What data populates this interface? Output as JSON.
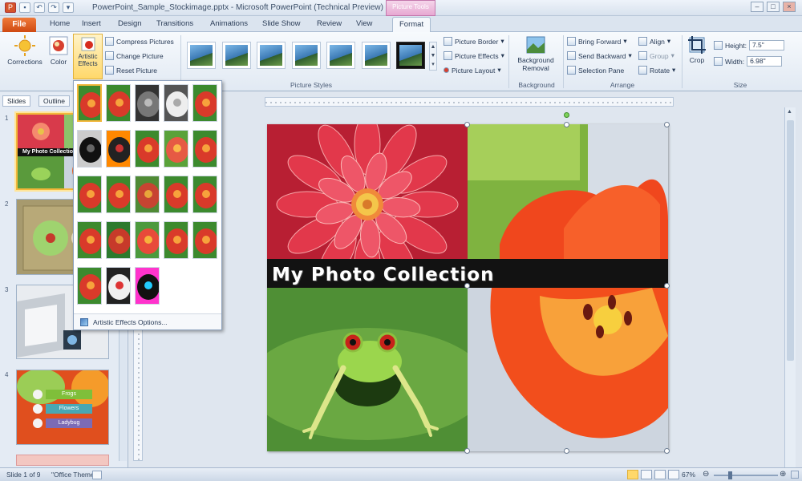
{
  "title_bar": {
    "title": "PowerPoint_Sample_Stockimage.pptx - Microsoft PowerPoint (Technical Preview)",
    "context_tab": "Picture Tools",
    "qat": [
      "save-icon",
      "undo-icon",
      "redo-icon",
      "customize-icon"
    ],
    "window_buttons": [
      "–",
      "□",
      "×"
    ]
  },
  "tabs": {
    "file": "File",
    "items": [
      "Home",
      "Insert",
      "Design",
      "Transitions",
      "Animations",
      "Slide Show",
      "Review",
      "View",
      "Format"
    ],
    "active": "Format"
  },
  "ribbon": {
    "corrections": "Corrections",
    "color": "Color",
    "artistic_effects": "Artistic Effects",
    "compress": "Compress Pictures",
    "change": "Change Picture",
    "reset": "Reset Picture",
    "picture_styles_label": "Picture Styles",
    "picture_border": "Picture Border",
    "picture_effects": "Picture Effects",
    "picture_layout": "Picture Layout",
    "background_removal": "Background Removal",
    "background_label": "Background",
    "bring_forward": "Bring Forward",
    "send_backward": "Send Backward",
    "selection_pane": "Selection Pane",
    "align": "Align",
    "group": "Group",
    "rotate": "Rotate",
    "arrange_label": "Arrange",
    "crop": "Crop",
    "height_label": "Height:",
    "height_value": "7.5\"",
    "width_label": "Width:",
    "width_value": "6.98\"",
    "size_label": "Size"
  },
  "left_panel": {
    "tabs": [
      "Slides",
      "Outline"
    ],
    "slide_numbers": [
      "1",
      "2",
      "3",
      "4"
    ],
    "thumb1_title": "My Photo Collection",
    "thumb4_labels": [
      "Frogs",
      "Flowers",
      "Ladybug"
    ]
  },
  "dropdown": {
    "options_label": "Artistic Effects Options..."
  },
  "slide": {
    "title": "My Photo Collection"
  },
  "status": {
    "slide_info": "Slide 1 of 9",
    "theme": "\"Office Theme\"",
    "zoom": "67%"
  },
  "colors": {
    "file_tab": "#cf4a12",
    "context_tab": "#e7a8d2",
    "selection": "#f2b73a"
  }
}
